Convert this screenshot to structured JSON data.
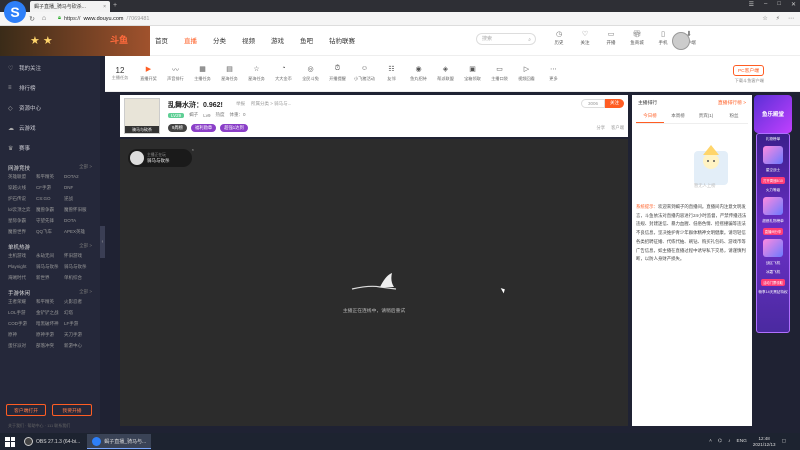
{
  "browser": {
    "tab_title": "蝎子直播_骑马与砍杀...",
    "tab_close": "×",
    "new_tab": "+",
    "url_prefix": "https://",
    "url_host": "www.douyu.com",
    "url_path": "/7069481",
    "lock_icon": "lock-icon"
  },
  "site": {
    "brand": "斗鱼",
    "nav": [
      "首页",
      "直播",
      "分类",
      "视频",
      "游戏",
      "鱼吧",
      "钻豹联赛"
    ],
    "nav_active": "直播",
    "search_placeholder": "搜索",
    "header_icons": [
      {
        "name": "history",
        "label": "历史"
      },
      {
        "name": "follow",
        "label": "关注"
      },
      {
        "name": "open-live",
        "label": "开播"
      },
      {
        "name": "shop",
        "label": "鱼商城"
      },
      {
        "name": "mobile",
        "label": "手机"
      },
      {
        "name": "download",
        "label": "客户端"
      }
    ]
  },
  "sidebar": {
    "items": [
      {
        "icon": "heart-icon",
        "label": "我的关注"
      },
      {
        "icon": "list-icon",
        "label": "排行榜"
      },
      {
        "icon": "shield-icon",
        "label": "资源中心"
      },
      {
        "icon": "cloud-icon",
        "label": "云游戏"
      },
      {
        "icon": "trophy-icon",
        "label": "赛事"
      }
    ],
    "sections": [
      {
        "title": "网游竞技",
        "more": "全部 >",
        "games": [
          "英雄联盟",
          "和平精英",
          "DOTA2",
          "穿越火线",
          "CF手游",
          "DNF",
          "炉石传说",
          "CS:GO",
          "逆战",
          "lol云顶之弈",
          "魔兽争霸",
          "魔兽怀旧服",
          "星际争霸",
          "守望先锋",
          "DOTA",
          "魔兽世界",
          "QQ飞车",
          "APEX英雄"
        ]
      },
      {
        "title": "单机热游",
        "more": "全部 >",
        "games": [
          "主机游戏",
          "永劫无间",
          "怀旧游戏",
          "Playnight",
          "骑马与砍杀",
          "骑马与砍杀",
          "海贼时代",
          "新世界",
          "单机综合"
        ]
      },
      {
        "title": "手游休闲",
        "more": "全部 >",
        "games": [
          "王者荣耀",
          "和平精英",
          "火影忍者",
          "LOL手游",
          "金铲铲之战",
          "幻塔",
          "COD手游",
          "暗黑破坏神",
          "LF手游",
          "原神",
          "原神手游",
          "天刀手游",
          "蛋仔派对",
          "部落冲突",
          "新游中心"
        ]
      }
    ],
    "btn_client": "客户端打开",
    "btn_open": "我要开播",
    "footer": "关于我们 · 帮助中心 · 111 联系我们",
    "collapse_icon": "chevron-left-icon"
  },
  "category_strip": {
    "count": "12",
    "count_label": "主播任务",
    "items": [
      {
        "icon": "live-icon",
        "label": "直播开奖",
        "hot": true
      },
      {
        "icon": "wave-icon",
        "label": "声音排行"
      },
      {
        "icon": "film-icon",
        "label": "主播任务"
      },
      {
        "icon": "grid-icon",
        "label": "星海任务"
      },
      {
        "icon": "star-icon",
        "label": "星海任务"
      },
      {
        "icon": "chat-icon",
        "label": "大大金币"
      },
      {
        "icon": "globe-icon",
        "label": "全民斗兔"
      },
      {
        "icon": "clock-icon",
        "label": "开播提醒"
      },
      {
        "icon": "person-icon",
        "label": "小飞猪活动"
      },
      {
        "icon": "team-icon",
        "label": "友邻"
      },
      {
        "icon": "lion-icon",
        "label": "鱼丸招待"
      },
      {
        "icon": "gift-icon",
        "label": "帮派联盟"
      },
      {
        "icon": "bag-icon",
        "label": "宝箱领取"
      },
      {
        "icon": "card-icon",
        "label": "主播口袋"
      },
      {
        "icon": "video-icon",
        "label": "视频回看"
      },
      {
        "icon": "more-icon",
        "label": "更多"
      }
    ],
    "pc_btn": "PC客户端",
    "pc_sub": "下载斗鱼客户端"
  },
  "room": {
    "title": "乱舞水浒：0.962!",
    "meta": [
      "举报",
      "所属分类 > 骑马与..."
    ],
    "badge": "骑马与砍杀",
    "tag": "LV29",
    "streamer": "蝎子",
    "level": "Lv9",
    "hot": "热度",
    "weight": "体重：0",
    "follow_count": "3006",
    "follow_btn": "关注",
    "pills": [
      "9周榜",
      "福利勋章",
      "超强1达到"
    ],
    "tools": [
      "分享",
      "客户端"
    ],
    "anchor_t1": "主播正在玩",
    "anchor_t2": "骑马与砍杀",
    "anchor_close": "×",
    "offline_msg": "主播正在连线中，请稍后重试"
  },
  "right_panel": {
    "rank_title": "主播排行",
    "rank_link": "直播排行榜 >",
    "tabs": [
      "今日榜",
      "本周榜",
      "贵宾(1)",
      "粉丝"
    ],
    "empty_msg": "暂无人上榜",
    "notice_label": "系统提示：",
    "notice": "欢迎来到蝎子的直播间。直播间内注意文明发言，斗鱼依法对直播内容进行24小时监督，严禁传播违法违规、封建迷信、暴力血腥、低俗色情、招摇撞骗等违法不良信息，坚决维护青少年群体精神文明健康。请勿轻信各类招聘征婚、代练代抽、刷钻、购买礼包码、游戏币等广告信息，如主播在直播过程中诱导私下交易，请谨慎判断，以防人身财产损失。"
  },
  "ads": {
    "ad1": "鱼乐殿堂",
    "labels": [
      "礼物榜单",
      "星空战士",
      "打开周冠8/10",
      "火力等级",
      "超燃礼物榜单",
      "直播间分享",
      "战区飞机",
      "冰霜飞机",
      "活动门票领取",
      "畅享14天黑钻特权"
    ]
  },
  "taskbar": {
    "items": [
      {
        "label": "OBS 27.1.3 (64-bi...",
        "active": false
      },
      {
        "label": "蝎子直播_骑马与...",
        "active": true
      }
    ],
    "tray": [
      "ENG"
    ],
    "time": "12:48",
    "date": "2021/12/13"
  },
  "colors": {
    "accent": "#ff5d23",
    "sidebar_bg": "#25283a",
    "player_bg": "#2c2c2c"
  }
}
